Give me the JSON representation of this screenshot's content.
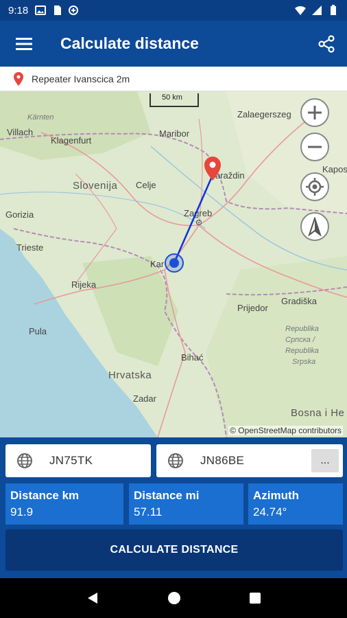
{
  "statusbar": {
    "time": "9:18"
  },
  "appbar": {
    "title": "Calculate distance"
  },
  "location": {
    "label": "Repeater Ivanscica 2m"
  },
  "map": {
    "scale": "50 km",
    "attribution": "© OpenStreetMap contributors",
    "labels": {
      "klagenfurt": "Klagenfurt",
      "villach": "Villach",
      "karnten": "Kärnten",
      "maribor": "Maribor",
      "slovenija": "Slovenija",
      "celje": "Celje",
      "zalaegerszeg": "Zalaegerszeg",
      "varazdin": "araždin",
      "kaposv": "Kaposv",
      "gorizia": "Gorizia",
      "zagreb": "Zagreb",
      "trieste": "Trieste",
      "rijeka": "Rijeka",
      "karlovac": "Kar",
      "pula": "Pula",
      "prijedor": "Prijedor",
      "gradiska": "Gradiška",
      "republika1": "Republika",
      "republika2": "Српска /",
      "republika3": "Republika",
      "republika4": "Srpska",
      "bihac": "Bihać",
      "hrvatska": "Hrvatska",
      "zadar": "Zadar",
      "bosna": "Bosna i He"
    }
  },
  "inputs": {
    "from_locator": "JN75TK",
    "to_locator": "JN86BE",
    "more_label": "..."
  },
  "results": {
    "km_label": "Distance km",
    "km_value": "91.9",
    "mi_label": "Distance mi",
    "mi_value": "57.11",
    "az_label": "Azimuth",
    "az_value": "24.74°"
  },
  "actions": {
    "calculate_label": "CALCULATE DISTANCE"
  },
  "colors": {
    "primary": "#0d4a98",
    "stat": "#1a6fd0",
    "button": "#0a3676",
    "route": "#1030e0",
    "pin": "#e8453c"
  }
}
